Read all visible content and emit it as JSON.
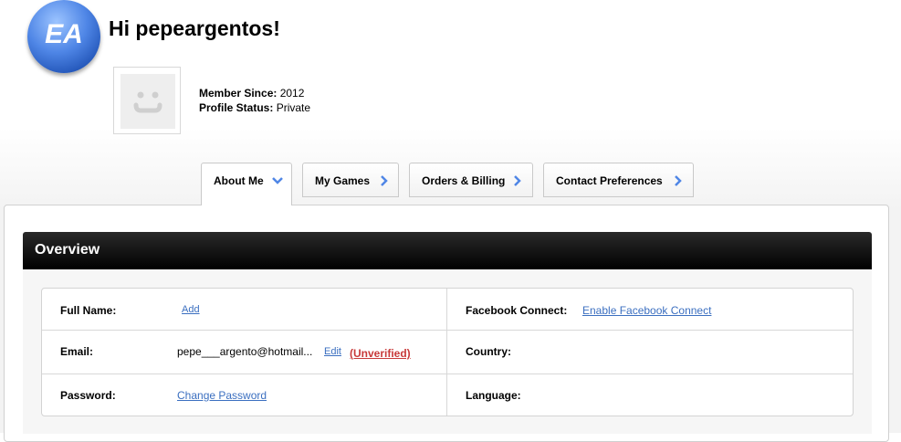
{
  "header": {
    "logo_text": "EA",
    "greeting": "Hi pepeargentos!",
    "member_since_label": "Member Since:",
    "member_since_value": "2012",
    "profile_status_label": "Profile Status:",
    "profile_status_value": "Private"
  },
  "tabs": [
    {
      "label": "About Me",
      "icon": "chevron-down-icon",
      "active": true
    },
    {
      "label": "My Games",
      "icon": "chevron-right-icon"
    },
    {
      "label": "Orders & Billing",
      "icon": "chevron-right-icon"
    },
    {
      "label": "Contact Preferences",
      "icon": "chevron-right-icon"
    }
  ],
  "overview": {
    "title": "Overview",
    "full_name_label": "Full Name:",
    "full_name_action": "Add",
    "email_label": "Email:",
    "email_value": "pepe___argento@hotmail...",
    "email_edit": "Edit",
    "email_status": "(Unverified)",
    "password_label": "Password:",
    "password_action": "Change Password",
    "facebook_label": "Facebook Connect:",
    "facebook_action": "Enable Facebook Connect",
    "country_label": "Country:",
    "language_label": "Language:"
  },
  "colors": {
    "link": "#3b6fc0",
    "warning": "#c83a3a",
    "chevron": "#4f86e6",
    "header_bar": "#000000"
  }
}
